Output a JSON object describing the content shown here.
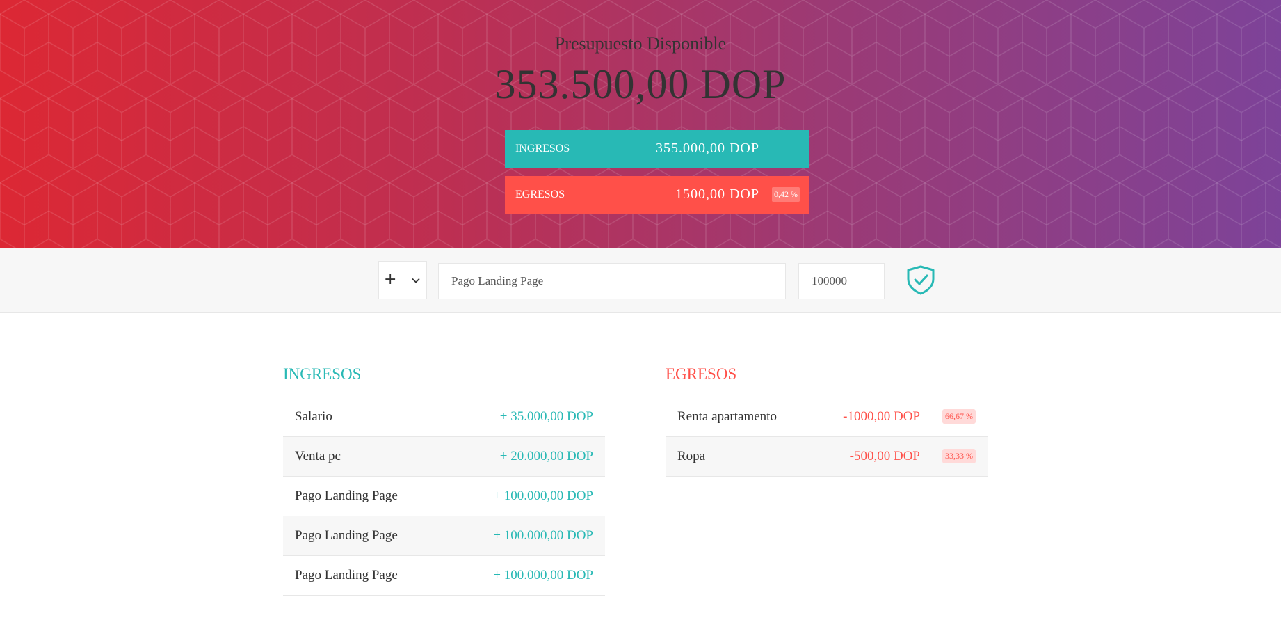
{
  "budget": {
    "title": "Presupuesto Disponible",
    "value": "353.500,00 DOP"
  },
  "summary": {
    "income_label": "Ingresos",
    "income_value": "355.000,00 DOP",
    "expense_label": "Egresos",
    "expense_value": "1500,00 DOP",
    "expense_percentage": "0,42 %"
  },
  "add_form": {
    "type_value": "+",
    "description_value": "Pago Landing Page",
    "amount_value": "100000",
    "submit_icon": "shield-check-icon"
  },
  "income_list": {
    "title": "Ingresos",
    "items": [
      {
        "description": "Salario",
        "amount": "+ 35.000,00 DOP"
      },
      {
        "description": "Venta pc",
        "amount": "+ 20.000,00 DOP"
      },
      {
        "description": "Pago Landing Page",
        "amount": "+ 100.000,00 DOP"
      },
      {
        "description": "Pago Landing Page",
        "amount": "+ 100.000,00 DOP"
      },
      {
        "description": "Pago Landing Page",
        "amount": "+ 100.000,00 DOP"
      }
    ]
  },
  "expense_list": {
    "title": "Egresos",
    "items": [
      {
        "description": "Renta apartamento",
        "amount": "-1000,00 DOP",
        "percentage": "66,67 %"
      },
      {
        "description": "Ropa",
        "amount": "-500,00 DOP",
        "percentage": "33,33 %"
      }
    ]
  },
  "colors": {
    "income": "#28b9b5",
    "expense": "#ff5049",
    "gradient_start": "#dc2834",
    "gradient_end": "#7d4399"
  }
}
